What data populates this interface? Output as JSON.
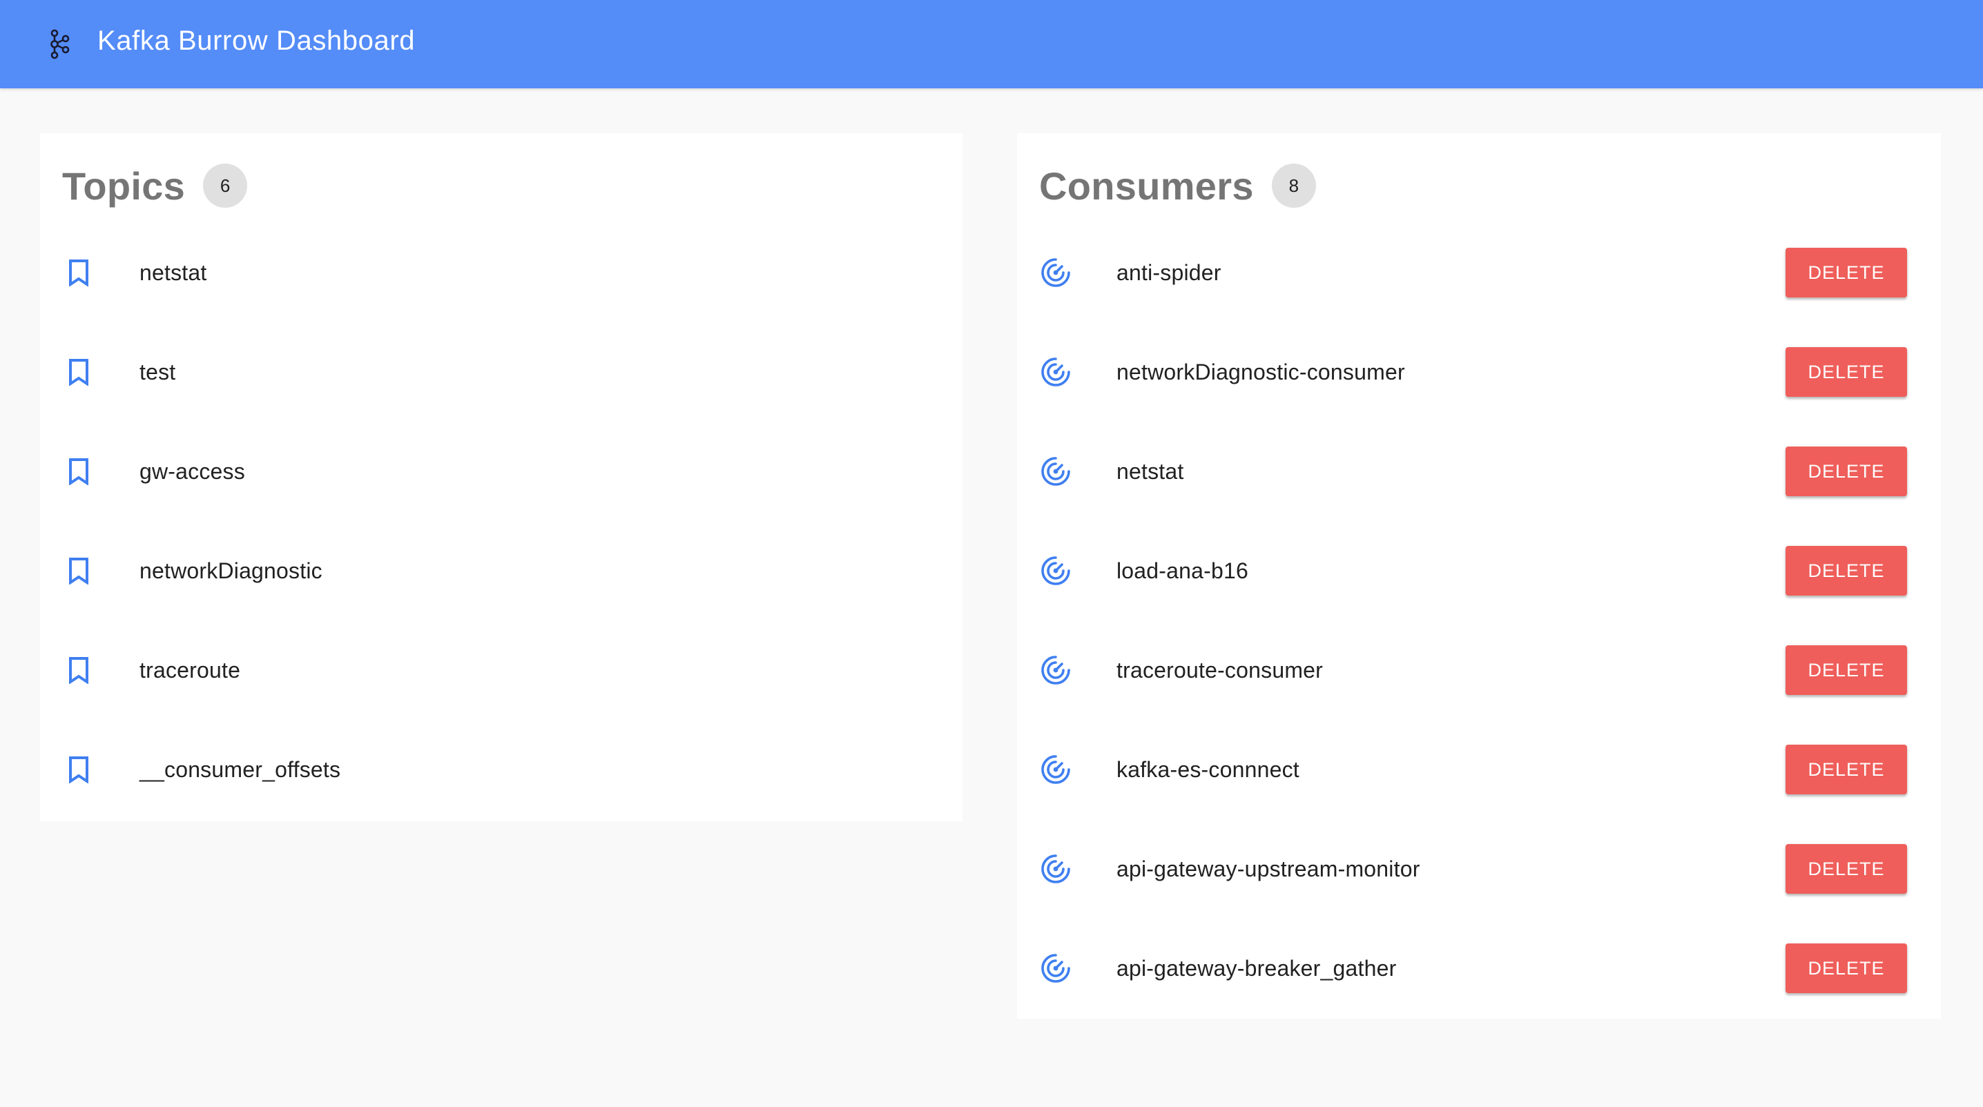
{
  "app": {
    "title": "Kafka Burrow Dashboard",
    "logo_icon": "kafka-logo-icon",
    "header_color": "#548cf8"
  },
  "topics": {
    "title": "Topics",
    "count": "6",
    "item_icon": "bookmark-icon",
    "items": [
      {
        "label": "netstat"
      },
      {
        "label": "test"
      },
      {
        "label": "gw-access"
      },
      {
        "label": "networkDiagnostic"
      },
      {
        "label": "traceroute"
      },
      {
        "label": "__consumer_offsets"
      }
    ]
  },
  "consumers": {
    "title": "Consumers",
    "count": "8",
    "item_icon": "radar-icon",
    "delete_label": "DELETE",
    "delete_color": "#ef5e5a",
    "items": [
      {
        "label": "anti-spider"
      },
      {
        "label": "networkDiagnostic-consumer"
      },
      {
        "label": "netstat"
      },
      {
        "label": "load-ana-b16"
      },
      {
        "label": "traceroute-consumer"
      },
      {
        "label": "kafka-es-connnect"
      },
      {
        "label": "api-gateway-upstream-monitor"
      },
      {
        "label": "api-gateway-breaker_gather"
      }
    ]
  }
}
